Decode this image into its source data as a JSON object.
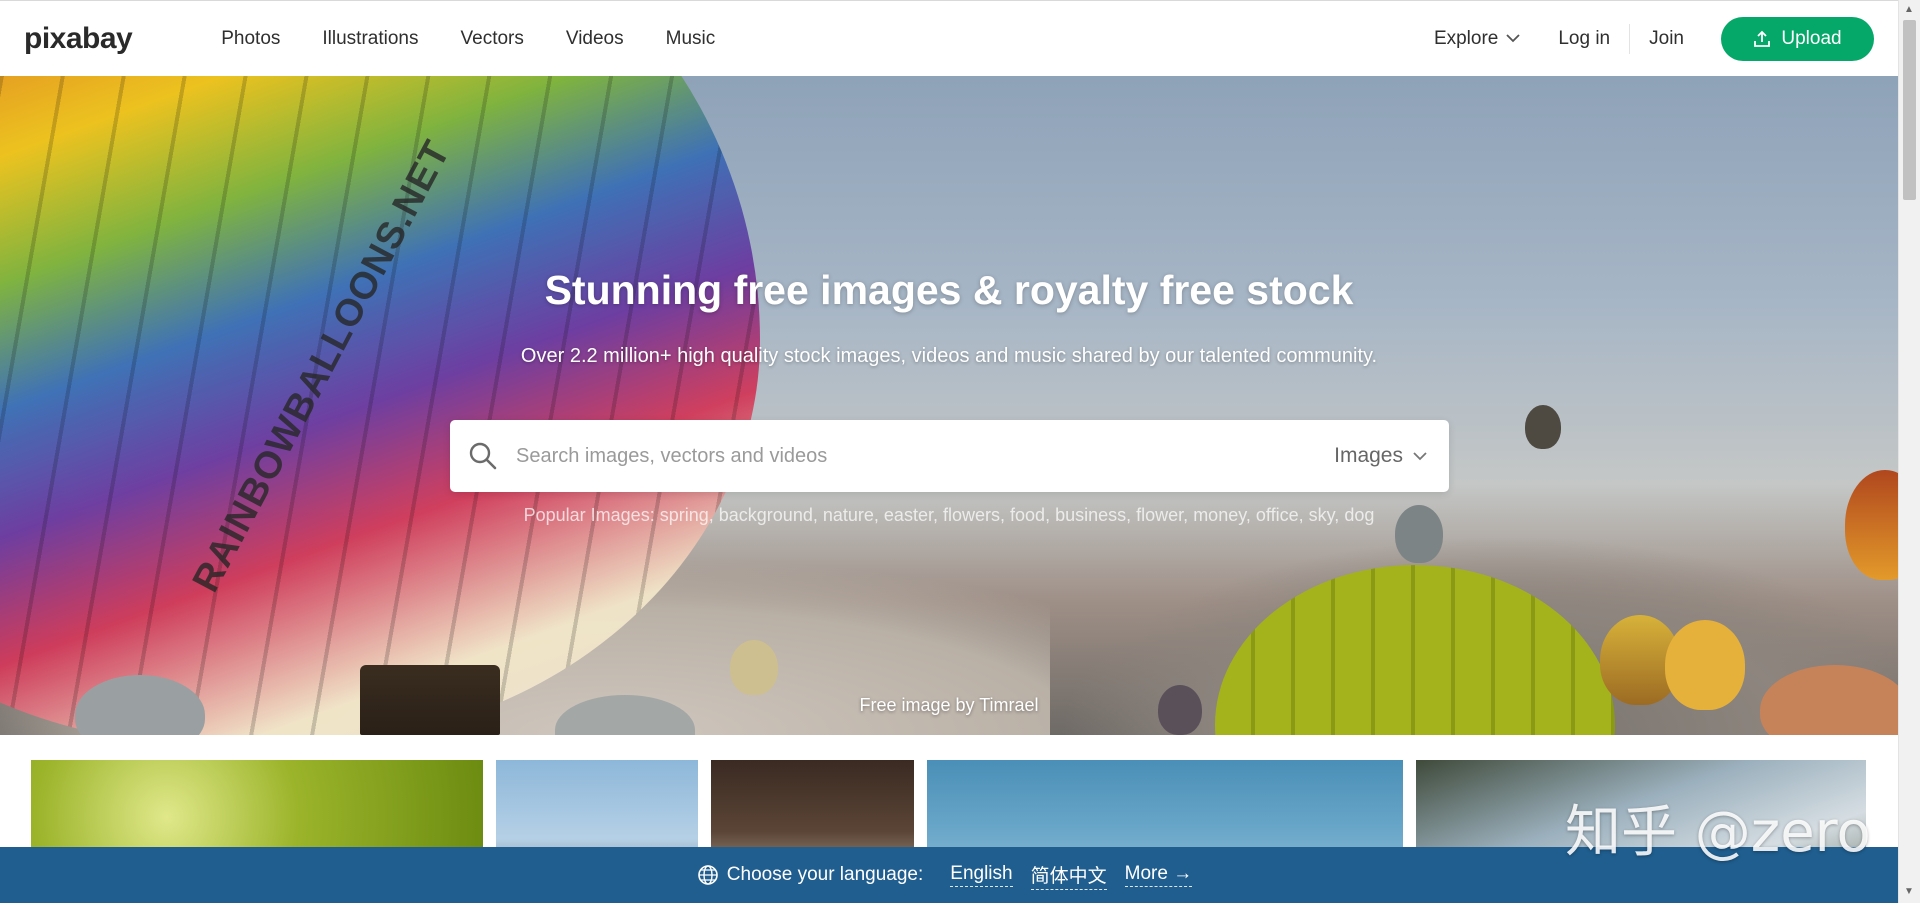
{
  "header": {
    "logo": "pixabay",
    "nav": [
      "Photos",
      "Illustrations",
      "Vectors",
      "Videos",
      "Music"
    ],
    "explore": "Explore",
    "login": "Log in",
    "join": "Join",
    "upload": "Upload",
    "upload_color": "#05a869"
  },
  "hero": {
    "balloon_text": "RAINBOWBALLOONS.NET",
    "title": "Stunning free images & royalty free stock",
    "subtitle": "Over 2.2 million+ high quality stock images, videos and music shared by our talented community.",
    "search_placeholder": "Search images, vectors and videos",
    "search_type": "Images",
    "popular_label": "Popular Images:",
    "popular_tags": [
      "spring",
      "background",
      "nature",
      "easter",
      "flowers",
      "food",
      "business",
      "flower",
      "money",
      "office",
      "sky",
      "dog"
    ],
    "credit_prefix": "Free image by",
    "credit_author": "Timrael"
  },
  "language_bar": {
    "label": "Choose your language:",
    "options": [
      "English",
      "简体中文",
      "More →"
    ],
    "bg_color": "#1f5e8f"
  },
  "watermark": "知乎 @zero"
}
